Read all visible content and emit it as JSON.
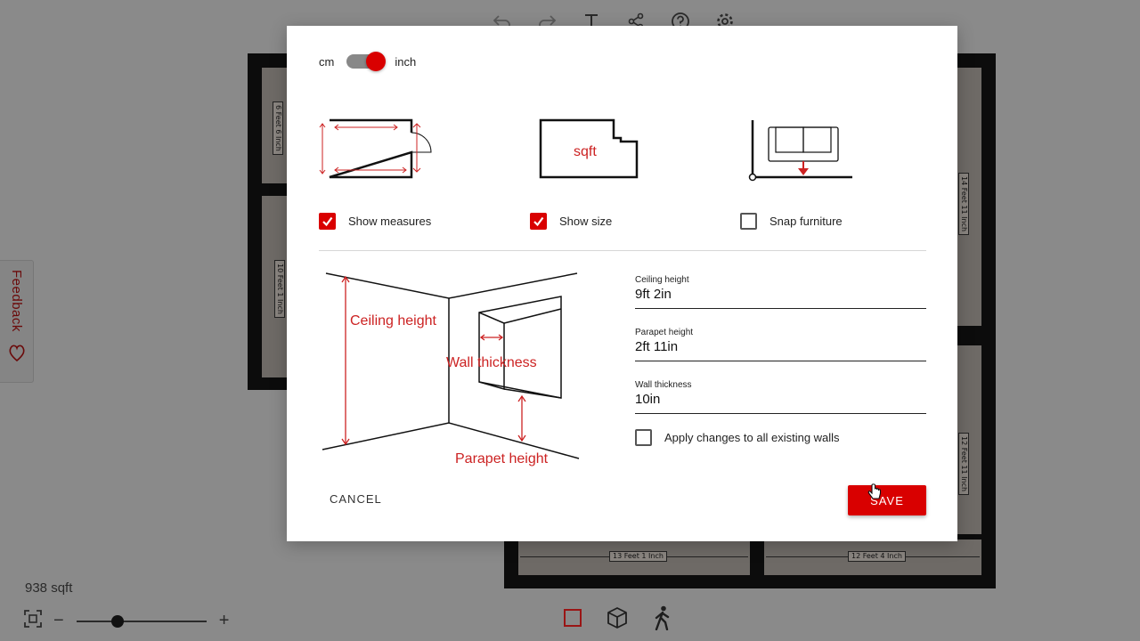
{
  "canvas": {
    "dimensions": [
      "6 Feet 6 Inch",
      "10 Feet 1 Inch",
      "14 Feet 11 Inch",
      "12 Feet 11 Inch",
      "13 Feet 1 Inch",
      "12 Feet 4 Inch"
    ]
  },
  "toolbar": {
    "icons": [
      "undo-icon",
      "redo-icon",
      "text-icon",
      "share-icon",
      "help-icon",
      "settings-icon"
    ]
  },
  "feedback": {
    "label": "Feedback"
  },
  "status": {
    "area": "938 sqft"
  },
  "zoom": {
    "minus": "−",
    "plus": "+",
    "level": 0.32
  },
  "bottom_tools": [
    "2d-view-icon",
    "3d-view-icon",
    "walk-mode-icon"
  ],
  "modal": {
    "units": {
      "left": "cm",
      "right": "inch",
      "selected": "inch"
    },
    "options": [
      {
        "label": "Show measures",
        "checked": true
      },
      {
        "label": "Show size",
        "checked": true,
        "illus_text": "sqft"
      },
      {
        "label": "Snap furniture",
        "checked": false
      }
    ],
    "illustration": {
      "ceiling": "Ceiling height",
      "wall": "Wall thickness",
      "parapet": "Parapet height"
    },
    "fields": {
      "ceiling": {
        "label": "Ceiling height",
        "value": "9ft 2in"
      },
      "parapet": {
        "label": "Parapet height",
        "value": "2ft 11in"
      },
      "wall": {
        "label": "Wall thickness",
        "value": "10in"
      }
    },
    "apply_all": {
      "label": "Apply changes to all existing walls",
      "checked": false
    },
    "cancel_label": "CANCEL",
    "save_label": "SAVE"
  },
  "colors": {
    "accent": "#d90000",
    "overlay": "#7a7a7a"
  }
}
